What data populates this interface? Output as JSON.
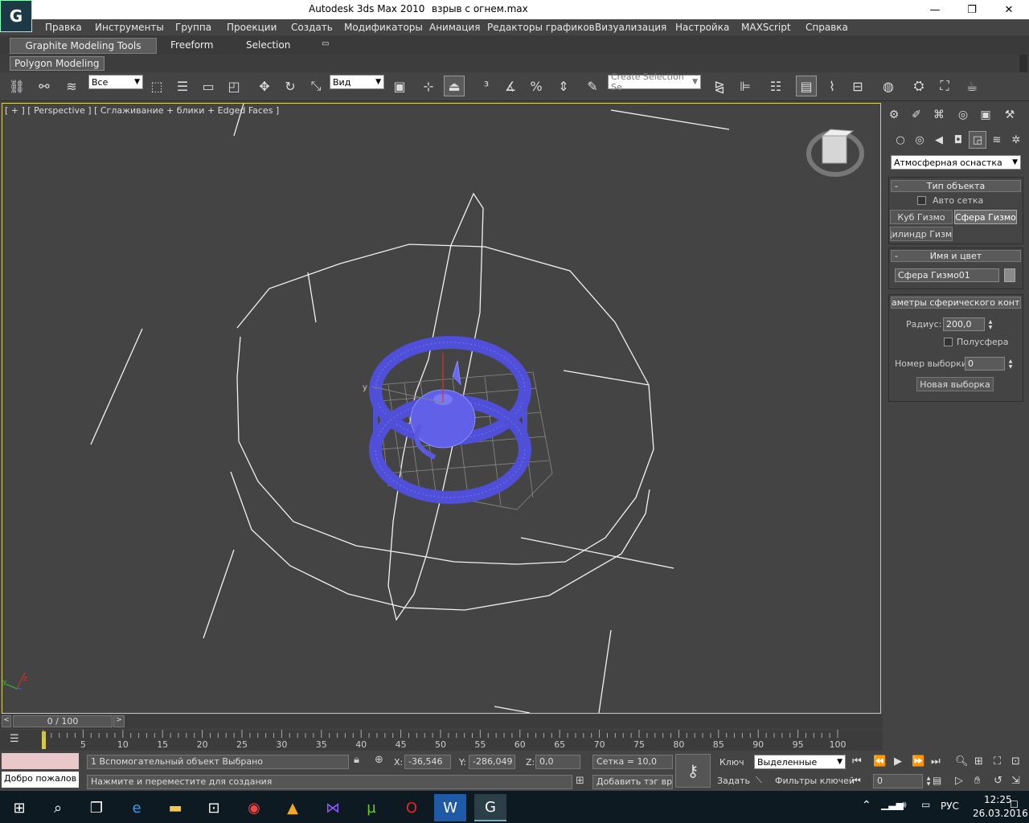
{
  "window": {
    "app_title": "Autodesk 3ds Max  2010",
    "doc_title": "взрыв с огнем.max",
    "minimize": "—",
    "maximize": "❐",
    "close": "✕"
  },
  "menu": [
    "Правка",
    "Инструменты",
    "Группа",
    "Проекции",
    "Создать",
    "Модификаторы",
    "Анимация",
    "Редакторы графиков",
    "Визуализация",
    "Настройка",
    "MAXScript",
    "Справка"
  ],
  "ribbon": {
    "tabs": [
      "Graphite Modeling Tools",
      "Freeform",
      "Selection"
    ],
    "sub_tab": "Polygon Modeling"
  },
  "toolbar": {
    "selection_filter": "Все",
    "ref_coord": "Вид",
    "named_selection_placeholder": "Create Selection Se"
  },
  "viewport": {
    "label": "[ + ] [ Perspective ] [ Сглаживание + блики + Edged Faces ]"
  },
  "command_panel": {
    "category": "Атмосферная оснастка",
    "object_type": {
      "header": "Тип объекта",
      "auto_grid": "Авто сетка",
      "buttons": [
        "Куб Гизмо",
        "Сфера Гизмо",
        "Цилиндр Гизмо"
      ]
    },
    "name_color": {
      "header": "Имя и цвет",
      "name": "Сфера Гизмо01",
      "color": "#8a8a8a"
    },
    "params": {
      "header": "аметры сферического контейн",
      "radius_label": "Радиус:",
      "radius": "200,0",
      "hemisphere": "Полусфера",
      "seed_label": "Номер выборки:",
      "seed": "0",
      "new_seed": "Новая выборка"
    }
  },
  "timeline": {
    "frame": "0 / 100",
    "ticks": [
      "5",
      "10",
      "15",
      "20",
      "25",
      "30",
      "35",
      "40",
      "45",
      "50",
      "55",
      "60",
      "65",
      "70",
      "75",
      "80",
      "85",
      "90",
      "95",
      "100"
    ]
  },
  "status": {
    "welcome": "Добро пожалов",
    "selected": "1 Вспомогательный объект Выбрано",
    "prompt": "Нажмите и переместите для создания",
    "x_label": "X:",
    "x": "-36,546",
    "y_label": "Y:",
    "y": "-286,049",
    "z_label": "Z:",
    "z": "0,0",
    "grid": "Сетка = 10,0",
    "add_tag": "Добавить тэг врем",
    "key_label": "Ключ",
    "set_label": "Задать",
    "key_mode": "Выделенные",
    "key_filters": "Фильтры ключей",
    "frame_field": "0"
  },
  "taskbar": {
    "lang": "РУС",
    "time": "12:25",
    "date": "26.03.2016"
  }
}
